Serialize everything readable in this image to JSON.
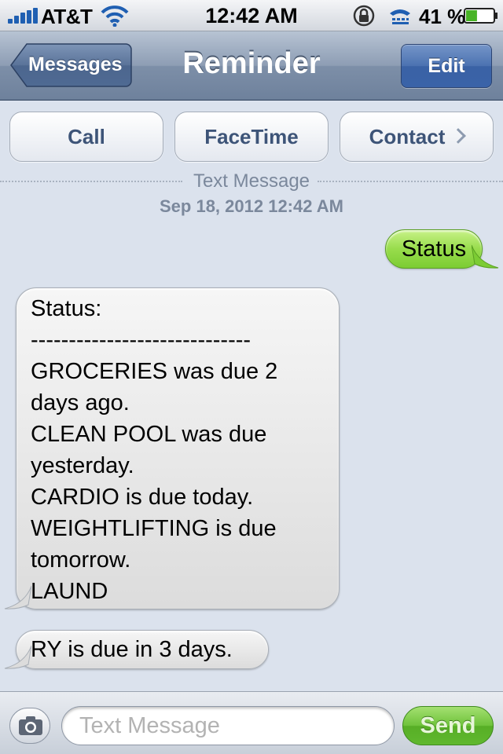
{
  "status_bar": {
    "carrier": "AT&T",
    "time": "12:42 AM",
    "battery_percent": "41 %",
    "battery_level": 0.41,
    "icons": [
      "signal-bars-icon",
      "wifi-icon",
      "rotation-lock-icon",
      "tty-icon",
      "battery-icon"
    ]
  },
  "nav": {
    "back_label": "Messages",
    "title": "Reminder",
    "edit_label": "Edit"
  },
  "actions": {
    "call": "Call",
    "facetime": "FaceTime",
    "contact": "Contact"
  },
  "thread": {
    "type_label": "Text Message",
    "date": "Sep 18, 2012 12:42 AM"
  },
  "messages": [
    {
      "direction": "outgoing",
      "text": "Status"
    },
    {
      "direction": "incoming",
      "lines": [
        "Status:",
        "-----------------------------",
        "GROCERIES was due 2",
        "days ago.",
        "CLEAN POOL was due",
        "yesterday.",
        "CARDIO is due today.",
        "WEIGHTLIFTING is due",
        "tomorrow.",
        "LAUND"
      ]
    },
    {
      "direction": "incoming",
      "text": "RY is due in 3 days."
    }
  ],
  "compose": {
    "placeholder": "Text Message",
    "send_label": "Send"
  },
  "colors": {
    "background": "#dbe2ed",
    "outgoing_bubble": "#98dc4c",
    "incoming_bubble": "#e6e6e6",
    "send_button": "#6ec23a",
    "nav_bar": "#8d9db4"
  }
}
